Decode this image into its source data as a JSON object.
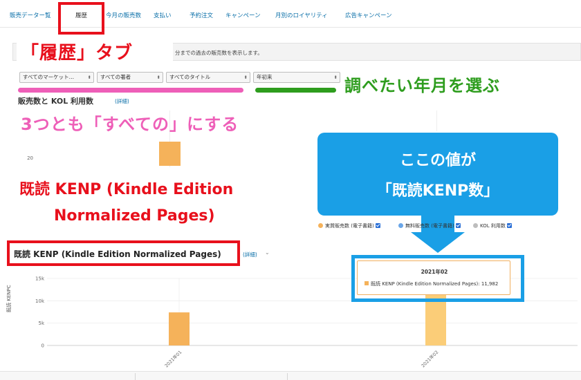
{
  "tabs": [
    {
      "label": "販売データー覧",
      "active": false
    },
    {
      "label": "履歴",
      "active": true
    },
    {
      "label": "今月の販売数",
      "active": false
    },
    {
      "label": "支払い",
      "active": false
    },
    {
      "label": "予約注文",
      "active": false
    },
    {
      "label": "キャンペーン",
      "active": false
    },
    {
      "label": "月別のロイヤリティ",
      "active": false
    },
    {
      "label": "広告キャンペーン",
      "active": false
    }
  ],
  "description": "分までの過去の販売数を表示します。",
  "filters": {
    "marketplace": "すべてのマーケット…",
    "author": "すべての著者",
    "title": "すべてのタイトル",
    "period": "年初来",
    "chevron": "⬍"
  },
  "chart_sales": {
    "title": "販売数と KOL 利用数",
    "detail_link": "(詳細)",
    "y_tick": "20"
  },
  "legend": [
    {
      "label": "実質販売数 (電子書籍)",
      "color": "#f5b25a",
      "checked": true
    },
    {
      "label": "無料販売数 (電子書籍)",
      "color": "#6aa6e8",
      "checked": true
    },
    {
      "label": "KOL 利用数",
      "color": "#bdbdbd",
      "checked": true
    }
  ],
  "chart_kenp": {
    "title": "既読 KENP (Kindle Edition Normalized Pages)",
    "detail_link": "(詳細)",
    "ylabel": "既読 KENPC",
    "y_ticks": [
      "15k",
      "10k",
      "5k",
      "0"
    ],
    "tooltip": {
      "title": "2021年02",
      "row_label": "既読 KENP (Kindle Edition Normalized Pages):",
      "row_value": "11,982"
    }
  },
  "chart_data": {
    "type": "bar",
    "categories": [
      "2021年01",
      "2021年02"
    ],
    "series": [
      {
        "name": "既読 KENP (Kindle Edition Normalized Pages)",
        "values": [
          7400,
          11982
        ]
      }
    ],
    "ylabel": "既読 KENPC",
    "ylim": [
      0,
      15000
    ],
    "y_ticks": [
      0,
      5000,
      10000,
      15000
    ],
    "bar_colors": [
      "#f5b25a",
      "#fbcd78"
    ]
  },
  "annotations": {
    "tab_callout": "「履歴」タブ",
    "select_period": "調べたい年月を選ぶ",
    "select_all": "3つとも「すべての」にする",
    "kenp_line1": "既読 KENP (Kindle Edition",
    "kenp_line2": "Normalized Pages)",
    "bubble_line1": "ここの値が",
    "bubble_line2": "「既読KENP数」"
  },
  "colors": {
    "annotation_red": "#e8101c",
    "annotation_pink": "#ee5fb8",
    "annotation_green": "#2e9d1e",
    "annotation_blue": "#1a9fe6",
    "bar_orange": "#f5b25a",
    "link_blue": "#0a6fa8"
  }
}
